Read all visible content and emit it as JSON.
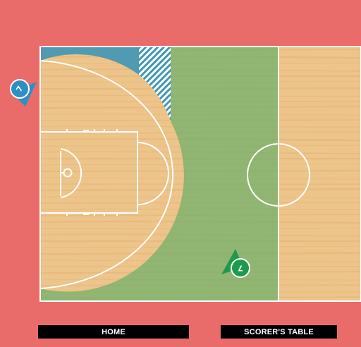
{
  "colors": {
    "surround": "#E96C6B",
    "wood": "#EDC48A",
    "wood_dark": "#E3B06E",
    "blue_zone": "#3E97B6",
    "green_zone": "#6DAF6A",
    "lines": "#FFFFFF",
    "official_blue": "#2E8FC4",
    "official_green": "#1E9A4C",
    "label_bg": "#000000",
    "label_text": "#FFFFFF"
  },
  "labels": {
    "home": "HOME",
    "scorers_table": "SCORER'S TABLE"
  },
  "officials": [
    {
      "name": "official-blue",
      "number": "7",
      "color_key": "official_blue",
      "marker": "blue-triangle-icon"
    },
    {
      "name": "official-green",
      "number": "7",
      "color_key": "official_green",
      "marker": "green-triangle-icon"
    }
  ],
  "zones": [
    {
      "name": "blue-coverage-zone",
      "color_key": "blue_zone"
    },
    {
      "name": "blue-hatched-zone",
      "color_key": "blue_zone",
      "pattern": "hatched"
    },
    {
      "name": "green-coverage-zone",
      "color_key": "green_zone"
    }
  ]
}
